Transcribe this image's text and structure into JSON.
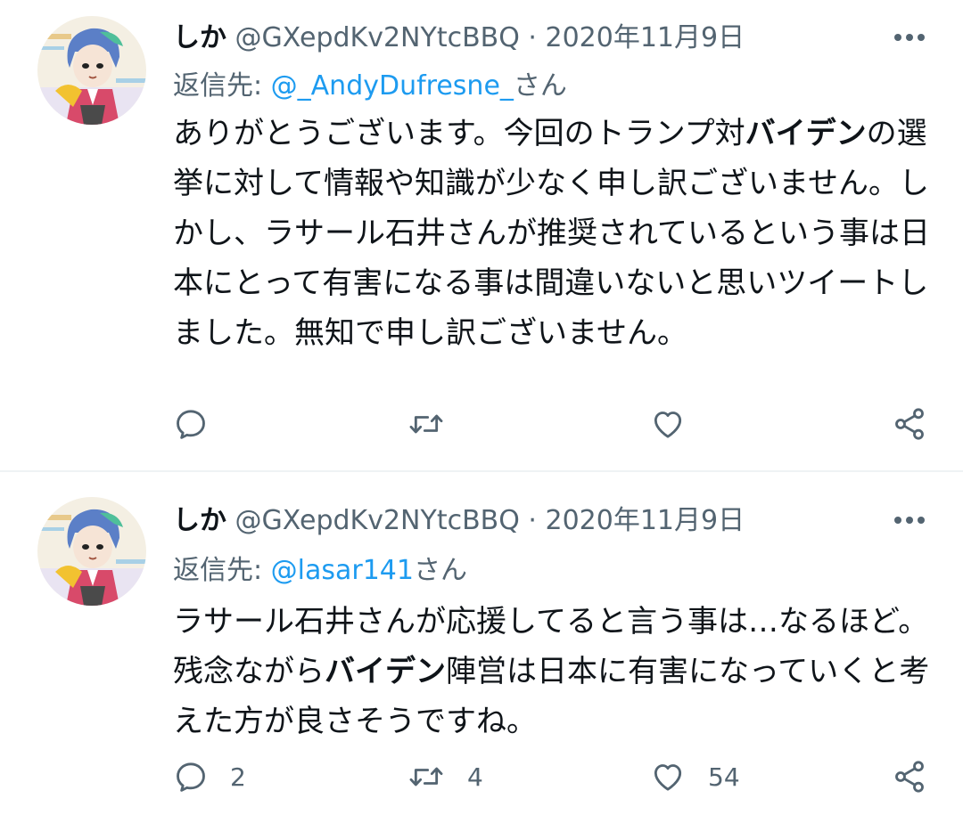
{
  "colors": {
    "text_primary": "#0f1419",
    "text_secondary": "#536471",
    "link": "#1d9bf0",
    "divider": "#eff3f4",
    "icon": "#536471"
  },
  "tweets": [
    {
      "display_name": "しか",
      "handle": "@GXepdKv2NYtcBBQ",
      "separator": "·",
      "date": "2020年11月9日",
      "more_icon": "more-dots-icon",
      "reply_prefix": "返信先: ",
      "reply_to": "@_AndyDufresne_",
      "reply_suffix": "さん",
      "text_segments": [
        {
          "text": "ありがとうございます。今回のトランプ対",
          "bold": false
        },
        {
          "text": "バイデン",
          "bold": true
        },
        {
          "text": "の選挙に対して情報や知識が少なく申し訳ございません。しかし、ラサール石井さんが推奨されているという事は日本にとって有害になる事は間違いないと思いツイートしました。無知で申し訳ございません。",
          "bold": false
        }
      ],
      "actions": {
        "reply": {
          "icon": "reply-icon",
          "count": ""
        },
        "retweet": {
          "icon": "retweet-icon",
          "count": ""
        },
        "like": {
          "icon": "heart-icon",
          "count": ""
        },
        "share": {
          "icon": "share-icon"
        }
      }
    },
    {
      "display_name": "しか",
      "handle": "@GXepdKv2NYtcBBQ",
      "separator": "·",
      "date": "2020年11月9日",
      "more_icon": "more-dots-icon",
      "reply_prefix": "返信先: ",
      "reply_to": "@lasar141",
      "reply_suffix": "さん",
      "text_segments": [
        {
          "text": "ラサール石井さんが応援してると言う事は…なるほど。残念ながら",
          "bold": false
        },
        {
          "text": "バイデン",
          "bold": true
        },
        {
          "text": "陣営は日本に有害になっていくと考えた方が良さそうですね。",
          "bold": false
        }
      ],
      "actions": {
        "reply": {
          "icon": "reply-icon",
          "count": "2"
        },
        "retweet": {
          "icon": "retweet-icon",
          "count": "4"
        },
        "like": {
          "icon": "heart-icon",
          "count": "54"
        },
        "share": {
          "icon": "share-icon"
        }
      }
    }
  ]
}
